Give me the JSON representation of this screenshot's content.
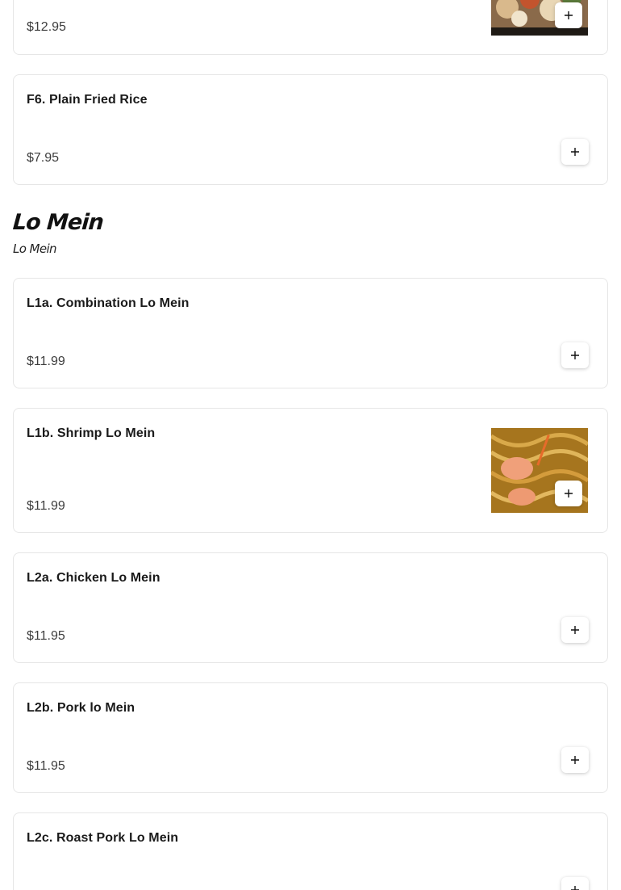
{
  "items_top": {
    "prev_item": {
      "price": "$12.95"
    },
    "plain_fried_rice": {
      "name": "F6. Plain Fried Rice",
      "price": "$7.95"
    }
  },
  "section": {
    "title": "Lo Mein",
    "subtitle": "Lo Mein"
  },
  "items": [
    {
      "name": "L1a. Combination Lo Mein",
      "price": "$11.99"
    },
    {
      "name": "L1b. Shrimp Lo Mein",
      "price": "$11.99"
    },
    {
      "name": "L2a. Chicken Lo Mein",
      "price": "$11.95"
    },
    {
      "name": "L2b. Pork lo Mein",
      "price": "$11.95"
    },
    {
      "name": "L2c. Roast Pork Lo Mein",
      "price": ""
    }
  ],
  "icons": {
    "add": "plus-icon"
  },
  "colors": {
    "border": "#e6e6e6",
    "price_text": "#3d3d3d"
  }
}
